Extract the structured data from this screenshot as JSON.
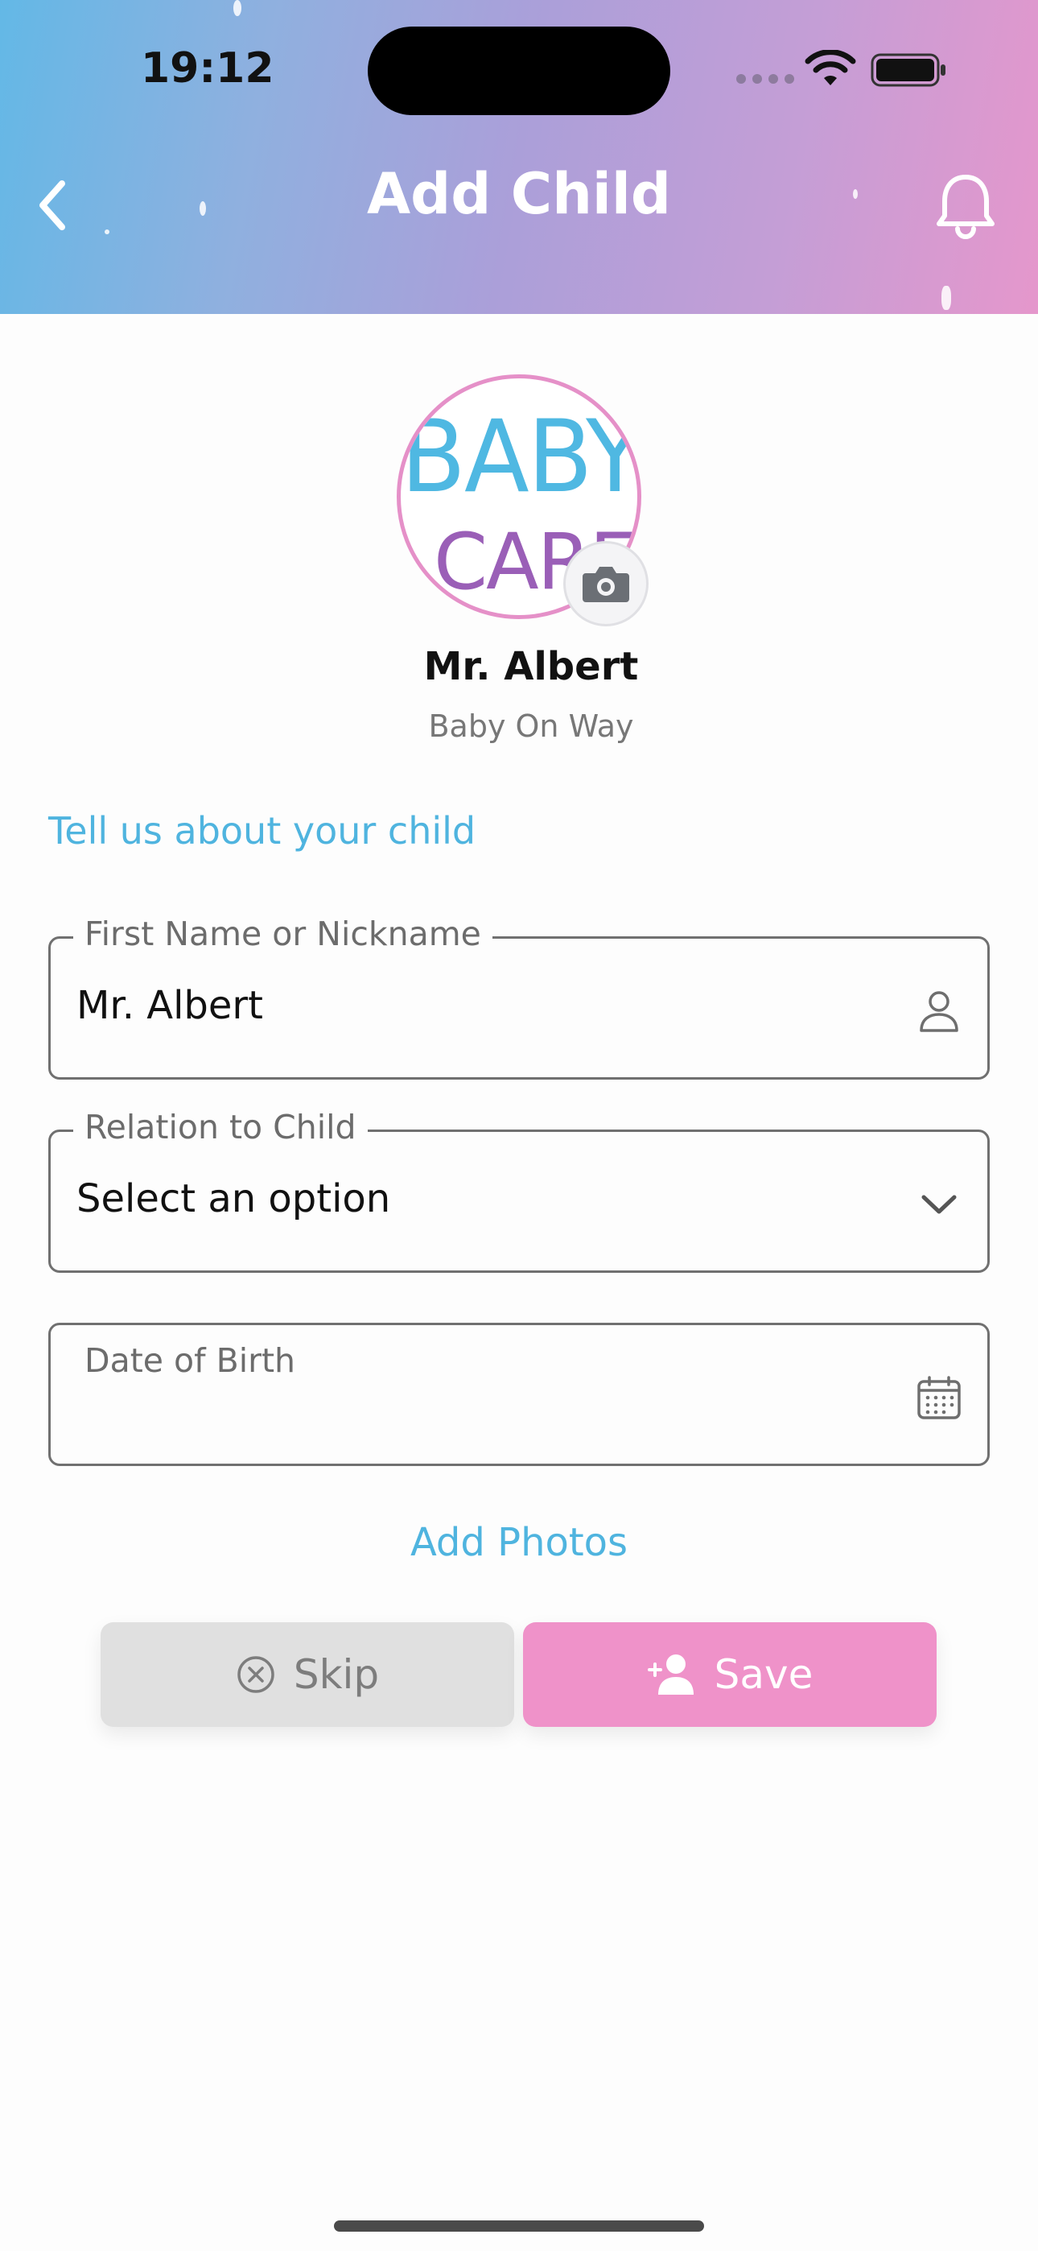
{
  "status_bar": {
    "time": "19:12"
  },
  "header": {
    "title": "Add Child",
    "back_icon": "chevron-left-icon",
    "notification_icon": "bell-icon"
  },
  "profile": {
    "avatar_logo": {
      "line1": "BABY",
      "line2": "CARE"
    },
    "name": "Mr. Albert",
    "status": "Baby On Way",
    "camera_icon": "camera-icon"
  },
  "form": {
    "section_title": "Tell us about your child",
    "first_name": {
      "label": "First Name or Nickname",
      "value": "Mr. Albert",
      "icon": "user-icon"
    },
    "relation": {
      "label": "Relation to Child",
      "selected": "Select an option",
      "icon": "chevron-down-icon"
    },
    "dob": {
      "label": "Date of Birth",
      "value": "",
      "icon": "calendar-icon"
    },
    "add_photos_label": "Add Photos"
  },
  "actions": {
    "skip_label": "Skip",
    "save_label": "Save"
  },
  "colors": {
    "accent_blue": "#4fb4df",
    "accent_pink": "#ef92c9",
    "skip_bg": "#e0e0e0"
  }
}
